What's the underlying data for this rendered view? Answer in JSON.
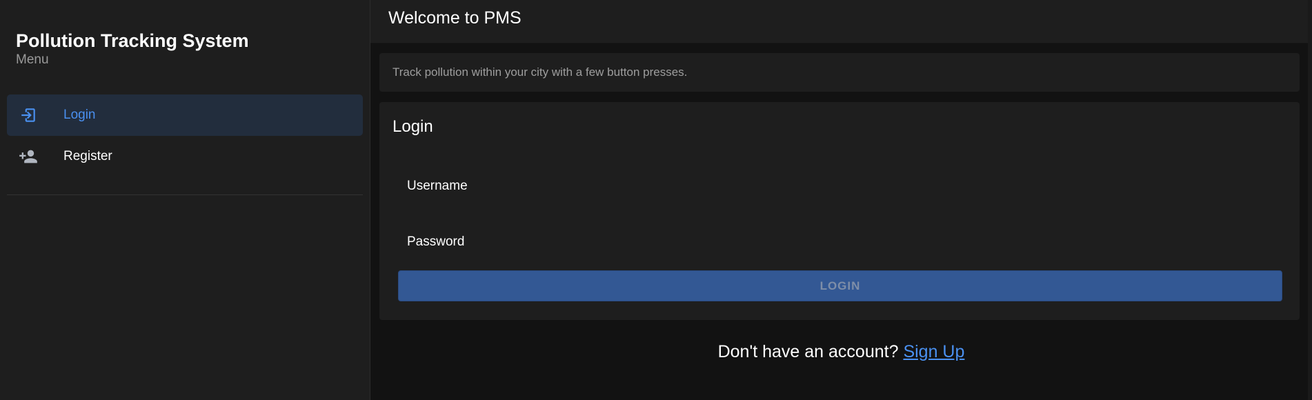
{
  "sidebar": {
    "title": "Pollution Tracking System",
    "subtitle": "Menu",
    "items": [
      {
        "label": "Login",
        "icon": "login-icon",
        "active": true
      },
      {
        "label": "Register",
        "icon": "person-add-icon",
        "active": false
      }
    ]
  },
  "header": {
    "title": "Welcome to PMS"
  },
  "info": {
    "text": "Track pollution within your city with a few button presses."
  },
  "login_form": {
    "title": "Login",
    "username_placeholder": "Username",
    "password_placeholder": "Password",
    "button_label": "LOGIN"
  },
  "signup": {
    "prompt": "Don't have an account?",
    "link_label": "Sign Up"
  },
  "colors": {
    "accent": "#4a90f0",
    "button_bg": "#335894",
    "sidebar_bg": "#1e1e1e",
    "page_bg": "#121212"
  }
}
